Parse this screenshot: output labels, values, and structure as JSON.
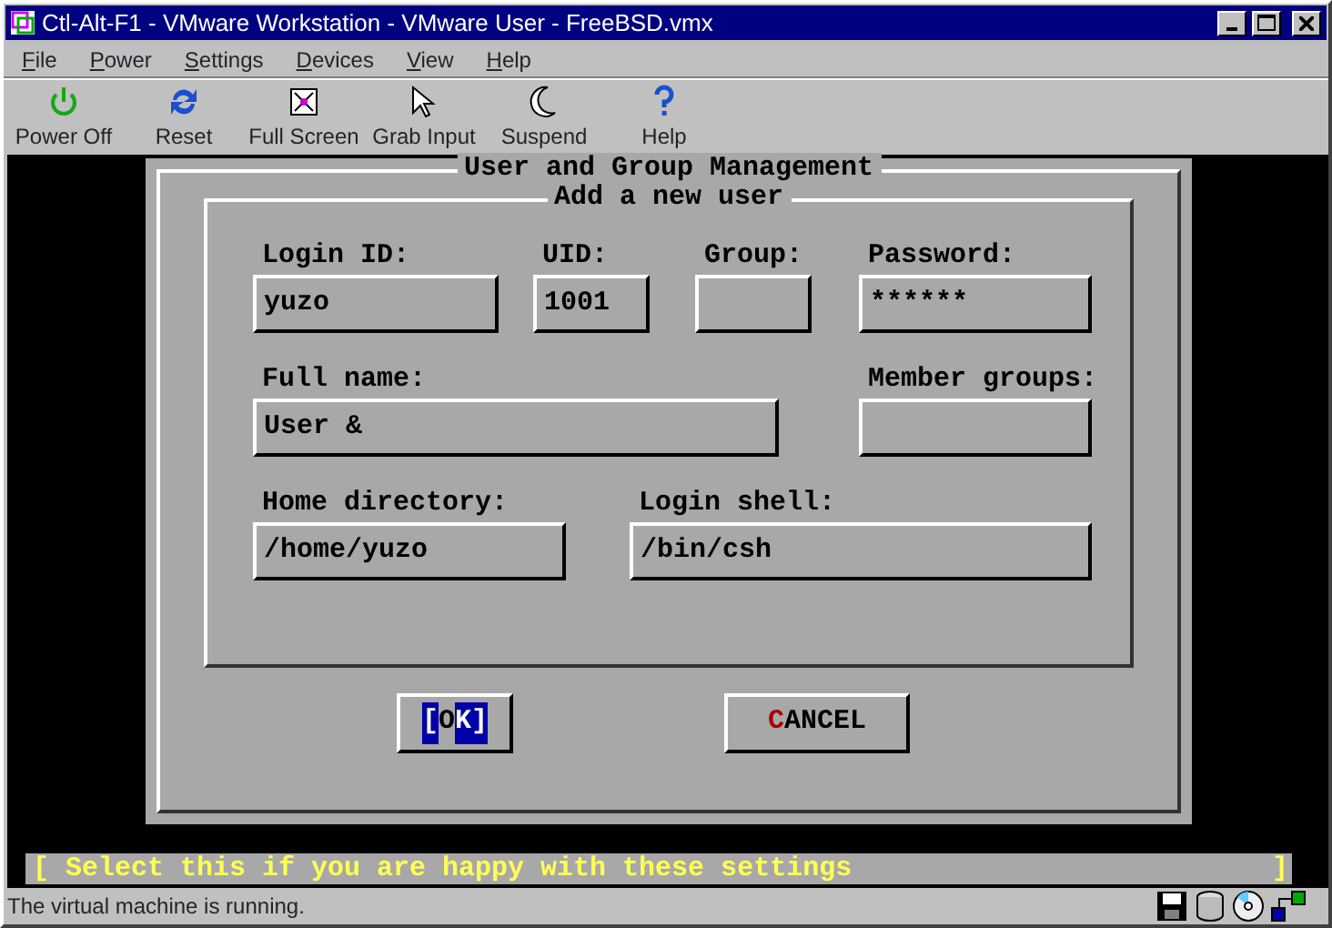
{
  "window": {
    "title": "Ctl-Alt-F1 - VMware Workstation - VMware User - FreeBSD.vmx"
  },
  "menu": [
    "File",
    "Power",
    "Settings",
    "Devices",
    "View",
    "Help"
  ],
  "toolbar": [
    {
      "kind": "power",
      "label": "Power Off"
    },
    {
      "kind": "reset",
      "label": "Reset"
    },
    {
      "kind": "fullscreen",
      "label": "Full Screen"
    },
    {
      "kind": "grab",
      "label": "Grab Input"
    },
    {
      "kind": "suspend",
      "label": "Suspend"
    },
    {
      "kind": "help",
      "label": "Help"
    }
  ],
  "dialog": {
    "title": "User and Group Management",
    "subtitle": "Add a new user",
    "fields": [
      {
        "label": "Login ID:",
        "value": "yuzo"
      },
      {
        "label": "UID:",
        "value": "1001"
      },
      {
        "label": "Group:"
      },
      {
        "label": "Password:",
        "value": "******"
      },
      {
        "label": "Full name:",
        "value": "User &"
      },
      {
        "label": "Member groups:"
      },
      {
        "label": "Home directory:",
        "value": "/home/yuzo"
      },
      {
        "label": "Login shell:",
        "value": "/bin/csh"
      }
    ],
    "buttons": [
      {
        "before": "[",
        "hotkey": "O",
        "after": "K]",
        "selected": true
      },
      {
        "hotkey": "C",
        "after": "ANCEL",
        "selected": false
      }
    ]
  },
  "hint": {
    "text": "[ Select this if you are happy with these settings",
    "end": "]"
  },
  "status_bar": {
    "text": "The virtual machine is running."
  }
}
